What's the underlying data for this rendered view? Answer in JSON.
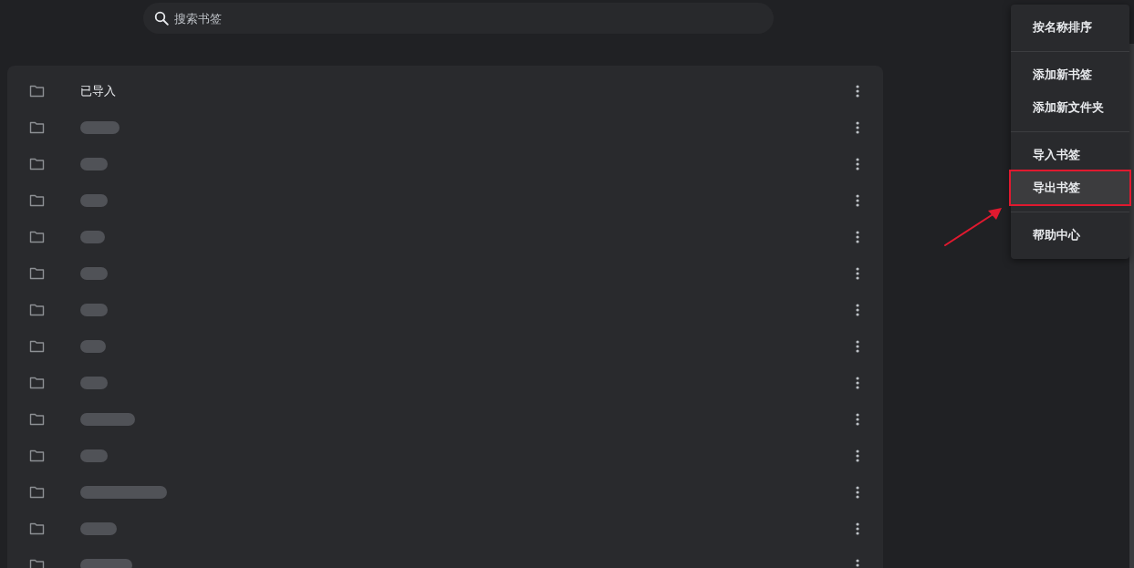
{
  "search": {
    "placeholder": "搜索书签"
  },
  "bookmarks": [
    {
      "kind": "folder",
      "title": "已导入"
    },
    {
      "kind": "folder-redacted"
    },
    {
      "kind": "folder-redacted"
    },
    {
      "kind": "folder-redacted"
    },
    {
      "kind": "folder-redacted"
    },
    {
      "kind": "folder-redacted"
    },
    {
      "kind": "folder-redacted"
    },
    {
      "kind": "folder-redacted"
    },
    {
      "kind": "folder-redacted"
    },
    {
      "kind": "folder-redacted"
    },
    {
      "kind": "folder-redacted"
    },
    {
      "kind": "folder-redacted"
    },
    {
      "kind": "folder-redacted"
    },
    {
      "kind": "folder-redacted"
    }
  ],
  "menu": {
    "groups": [
      [
        {
          "label": "按名称排序",
          "selected": false,
          "annotated": false
        }
      ],
      [
        {
          "label": "添加新书签",
          "selected": false,
          "annotated": false
        },
        {
          "label": "添加新文件夹",
          "selected": false,
          "annotated": false
        }
      ],
      [
        {
          "label": "导入书签",
          "selected": false,
          "annotated": false
        },
        {
          "label": "导出书签",
          "selected": true,
          "annotated": true
        }
      ],
      [
        {
          "label": "帮助中心",
          "selected": false,
          "annotated": false
        }
      ]
    ]
  }
}
